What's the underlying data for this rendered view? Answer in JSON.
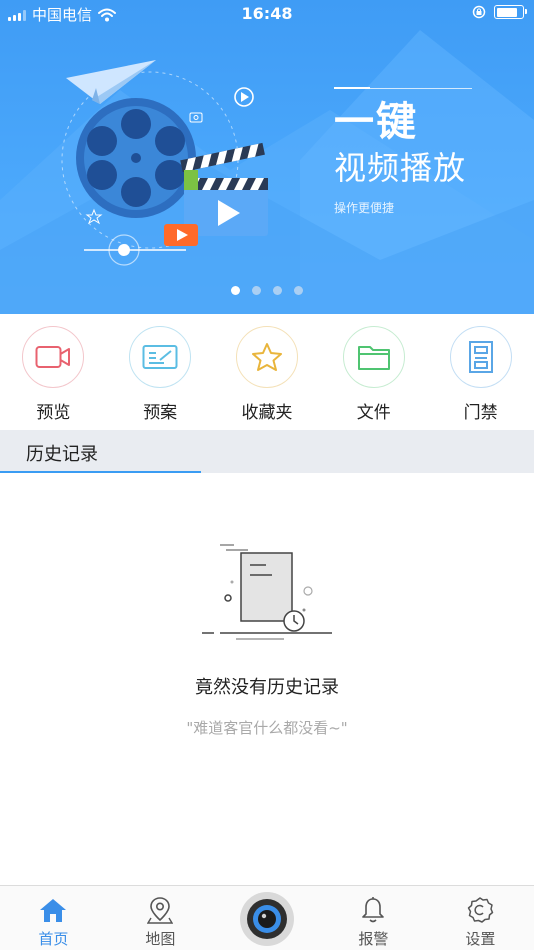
{
  "status_bar": {
    "carrier": "中国电信",
    "time": "16:48",
    "battery_level": 0.8
  },
  "banner": {
    "title": "一键",
    "subtitle": "视频播放",
    "note": "操作更便捷",
    "pages": 4,
    "active_page": 0
  },
  "quick_menu": {
    "items": [
      {
        "label": "预览",
        "icon": "video-camera-icon",
        "color": "#e8626f"
      },
      {
        "label": "预案",
        "icon": "plan-card-icon",
        "color": "#5bbde3"
      },
      {
        "label": "收藏夹",
        "icon": "star-icon",
        "color": "#e9b53c"
      },
      {
        "label": "文件",
        "icon": "folder-icon",
        "color": "#4fc471"
      },
      {
        "label": "门禁",
        "icon": "door-icon",
        "color": "#5aa6e6"
      }
    ]
  },
  "history_tab": {
    "label": "历史记录"
  },
  "empty_state": {
    "title": "竟然没有历史记录",
    "subtitle": "\"难道客官什么都没看~\""
  },
  "bottom_nav": {
    "items": [
      {
        "label": "首页",
        "icon": "home-icon",
        "active": true
      },
      {
        "label": "地图",
        "icon": "map-pin-icon",
        "active": false
      },
      {
        "label": "报警",
        "icon": "bell-icon",
        "active": false
      },
      {
        "label": "设置",
        "icon": "settings-gear-icon",
        "active": false
      }
    ],
    "center": {
      "icon": "camera-lens-icon"
    }
  },
  "colors": {
    "brand": "#3a9cf3",
    "active_nav": "#3a8ee8",
    "empty_subtitle": "#a9a9a9"
  }
}
